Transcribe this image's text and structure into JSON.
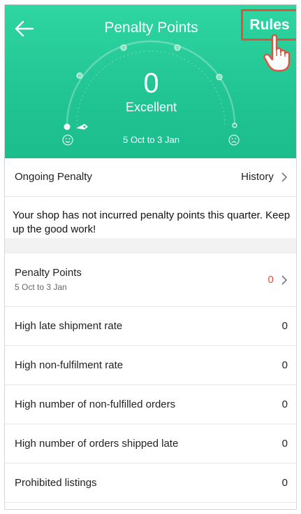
{
  "header": {
    "title": "Penalty Points",
    "rules_label": "Rules",
    "score": "0",
    "rating": "Excellent",
    "period": "5 Oct to 3 Jan",
    "gauge_level": 0,
    "colors": {
      "header_green": "#22c594",
      "highlight_red": "#e0523c"
    },
    "icons": {
      "back": "arrow-left-icon",
      "happy": "smiley-face-icon",
      "sad": "sad-face-icon",
      "pointer": "pointing-hand-icon"
    }
  },
  "ongoing": {
    "label": "Ongoing Penalty",
    "history_label": "History",
    "message": "Your shop has not incurred penalty points this quarter. Keep up the good work!"
  },
  "penalty_summary": {
    "label": "Penalty Points",
    "period": "5 Oct to 3 Jan",
    "value": "0",
    "value_color": "#e0523c"
  },
  "breakdown": [
    {
      "label": "High late shipment rate",
      "value": "0"
    },
    {
      "label": "High non-fulfilment rate",
      "value": "0"
    },
    {
      "label": "High number of non-fulfilled orders",
      "value": "0"
    },
    {
      "label": "High number of orders shipped late",
      "value": "0"
    },
    {
      "label": "Prohibited listings",
      "value": "0"
    }
  ]
}
